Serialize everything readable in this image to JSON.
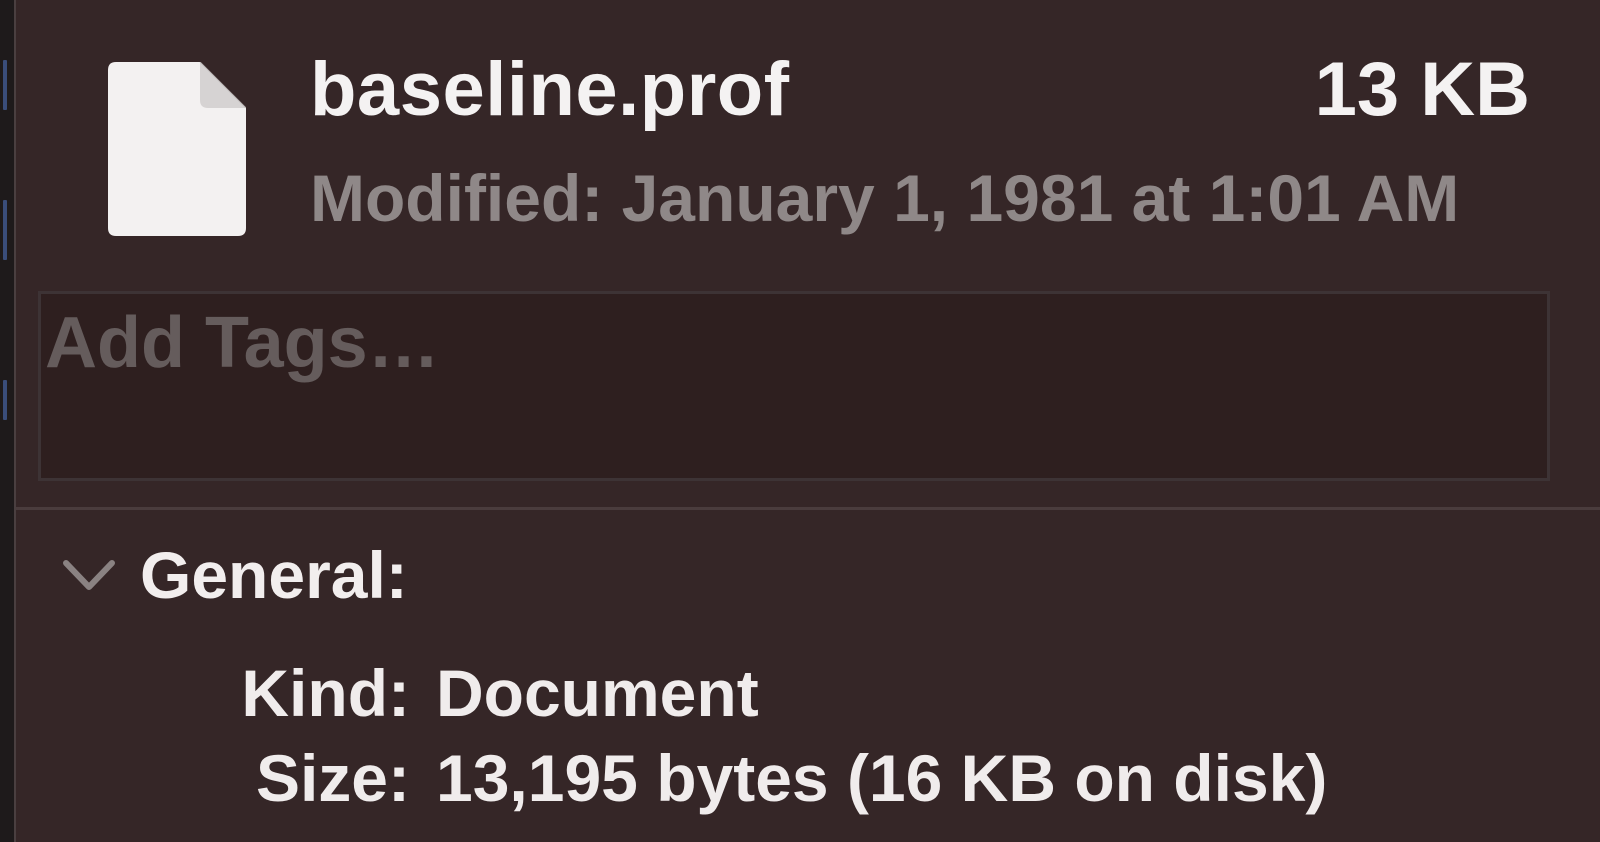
{
  "file": {
    "name": "baseline.prof",
    "size": "13 KB",
    "modified": "Modified: January 1, 1981 at 1:01 AM",
    "icon": "document-icon"
  },
  "tags": {
    "placeholder": "Add Tags…",
    "value": ""
  },
  "general": {
    "title": "General:",
    "expanded": true,
    "rows": [
      {
        "label": "Kind:",
        "value": "Document"
      },
      {
        "label": "Size:",
        "value": "13,195 bytes (16 KB on disk)"
      }
    ]
  },
  "colors": {
    "background": "#352627",
    "text_primary": "#f4f2f2",
    "text_secondary": "#8f8888",
    "placeholder": "#655c5c"
  }
}
